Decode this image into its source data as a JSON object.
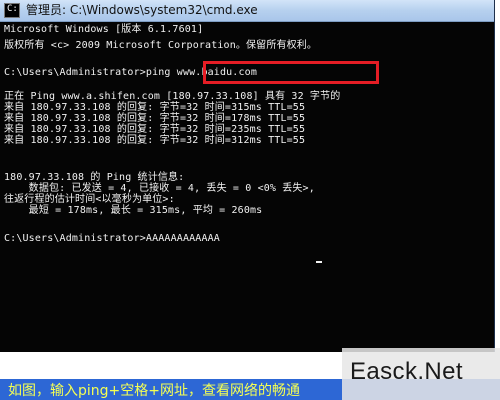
{
  "window": {
    "title": "管理员: C:\\Windows\\system32\\cmd.exe",
    "icon": "cmd-icon"
  },
  "console": {
    "lines": [
      "Microsoft Windows [版本 6.1.7601]",
      "版权所有 <c> 2009 Microsoft Corporation。保留所有权利。",
      "",
      "C:\\Users\\Administrator>ping www.baidu.com",
      "",
      "正在 Ping www.a.shifen.com [180.97.33.108] 具有 32 字节的",
      "来自 180.97.33.108 的回复: 字节=32 时间=315ms TTL=55",
      "来自 180.97.33.108 的回复: 字节=32 时间=178ms TTL=55",
      "来自 180.97.33.108 的回复: 字节=32 时间=235ms TTL=55",
      "来自 180.97.33.108 的回复: 字节=32 时间=312ms TTL=55",
      "",
      "180.97.33.108 的 Ping 统计信息:",
      "    数据包: 已发送 = 4, 已接收 = 4, 丢失 = 0 <0% 丢失>,",
      "往返行程的估计时间<以毫秒为单位>:",
      "    最短 = 178ms, 最长 = 315ms, 平均 = 260ms",
      "",
      "C:\\Users\\Administrator>AAAAAAAAAAAA"
    ]
  },
  "overlay": {
    "caption": "如图，输入ping+空格+网址，查看网络的畅通",
    "watermark": "Easck.Net"
  },
  "colors": {
    "console_background": "#050505",
    "console_text": "#f2f2f2",
    "highlight_border": "#e51d25",
    "caption_background": "#2d67d5",
    "caption_text": "#f5ff53"
  }
}
